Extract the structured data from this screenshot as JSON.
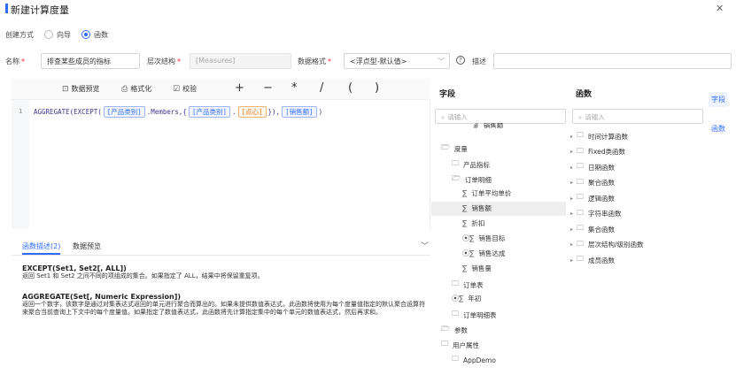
{
  "dialog": {
    "title": "新建计算度量"
  },
  "create_mode": {
    "label": "创建方式",
    "options": [
      "向导",
      "函数"
    ],
    "selected": "函数"
  },
  "form": {
    "name_label": "名称",
    "name_value": "排查某些成员的指标",
    "hierarchy_label": "层次结构",
    "hierarchy_value": "[Measures]",
    "format_label": "数据格式",
    "format_value": "<浮点型-默认值>",
    "desc_label": "描述",
    "required_mark": "*"
  },
  "toolbar": {
    "preview": "数据预览",
    "format": "格式化",
    "check": "校验",
    "ops": [
      "+",
      "−",
      "*",
      "/",
      "(",
      ")"
    ]
  },
  "editor": {
    "line_no": "1",
    "tokens": [
      {
        "t": "AGGREGATE(EXCEPT(",
        "k": "fn"
      },
      {
        "t": "[产品类别]",
        "k": "box"
      },
      {
        "t": ".Members,{",
        "k": "fn"
      },
      {
        "t": "[产品类别]",
        "k": "box"
      },
      {
        "t": ".",
        "k": "fn"
      },
      {
        "t": "[点心]",
        "k": "orange"
      },
      {
        "t": "}),",
        "k": "fn"
      },
      {
        "t": "[销售额]",
        "k": "box"
      },
      {
        "t": ")",
        "k": "fn"
      }
    ]
  },
  "desc_tabs": {
    "tab1": "函数描述(2)",
    "tab2": "数据预览"
  },
  "descriptions": [
    {
      "head": "EXCEPT(Set1, Set2[, ALL])",
      "body": "返回 Set1 和 Set2 之间不同的项组成的集合。如果指定了 ALL，结果中将保留重复项。"
    },
    {
      "head": "AGGREGATE(Set[, Numeric Expression])",
      "body": "返回一个数字，该数字是通过对集表达式返回的单元进行聚合而算出的。如果未提供数值表达式，此函数将使用为每个度量值指定的默认聚合运算符来聚合当前查询上下文中的每个度量值。如果指定了数值表达式，此函数将先计算指定集中的每个单元的数值表达式，然后再求和。"
    }
  ],
  "fields": {
    "title": "字段",
    "search_placeholder": "请输入",
    "items": [
      {
        "label": "销售额",
        "icon": "#",
        "indent": 3
      },
      {
        "label": "度量",
        "icon": "folder-open",
        "indent": 0
      },
      {
        "label": "产品指标",
        "icon": "folder",
        "indent": 1
      },
      {
        "label": "订单明细",
        "icon": "folder-open",
        "indent": 1
      },
      {
        "label": "订单平均单价",
        "icon": "sigma",
        "indent": 2
      },
      {
        "label": "销售额",
        "icon": "sigma",
        "indent": 2
      },
      {
        "label": "折扣",
        "icon": "sigma",
        "indent": 2
      },
      {
        "label": "销售目标",
        "icon": "sigma-k",
        "indent": 2
      },
      {
        "label": "销售达成",
        "icon": "sigma-k",
        "indent": 2
      },
      {
        "label": "销售量",
        "icon": "sigma",
        "indent": 2
      },
      {
        "label": "订单表",
        "icon": "folder",
        "indent": 1
      },
      {
        "label": "年初",
        "icon": "sigma-k",
        "indent": 1
      },
      {
        "label": "订单明细表",
        "icon": "folder",
        "indent": 1
      },
      {
        "label": "参数",
        "icon": "folder-open",
        "indent": 0
      },
      {
        "label": "用户属性",
        "icon": "user-folder",
        "indent": 0
      },
      {
        "label": "AppDemo",
        "icon": "folder",
        "indent": 1
      }
    ]
  },
  "functions": {
    "title": "函数",
    "search_placeholder": "请输入",
    "items": [
      "时间计算函数",
      "Fixed类函数",
      "日期函数",
      "聚合函数",
      "逻辑函数",
      "字符串函数",
      "集合函数",
      "层次结构/级别函数",
      "成员函数"
    ]
  },
  "side_tabs": [
    "字段",
    "函数"
  ]
}
